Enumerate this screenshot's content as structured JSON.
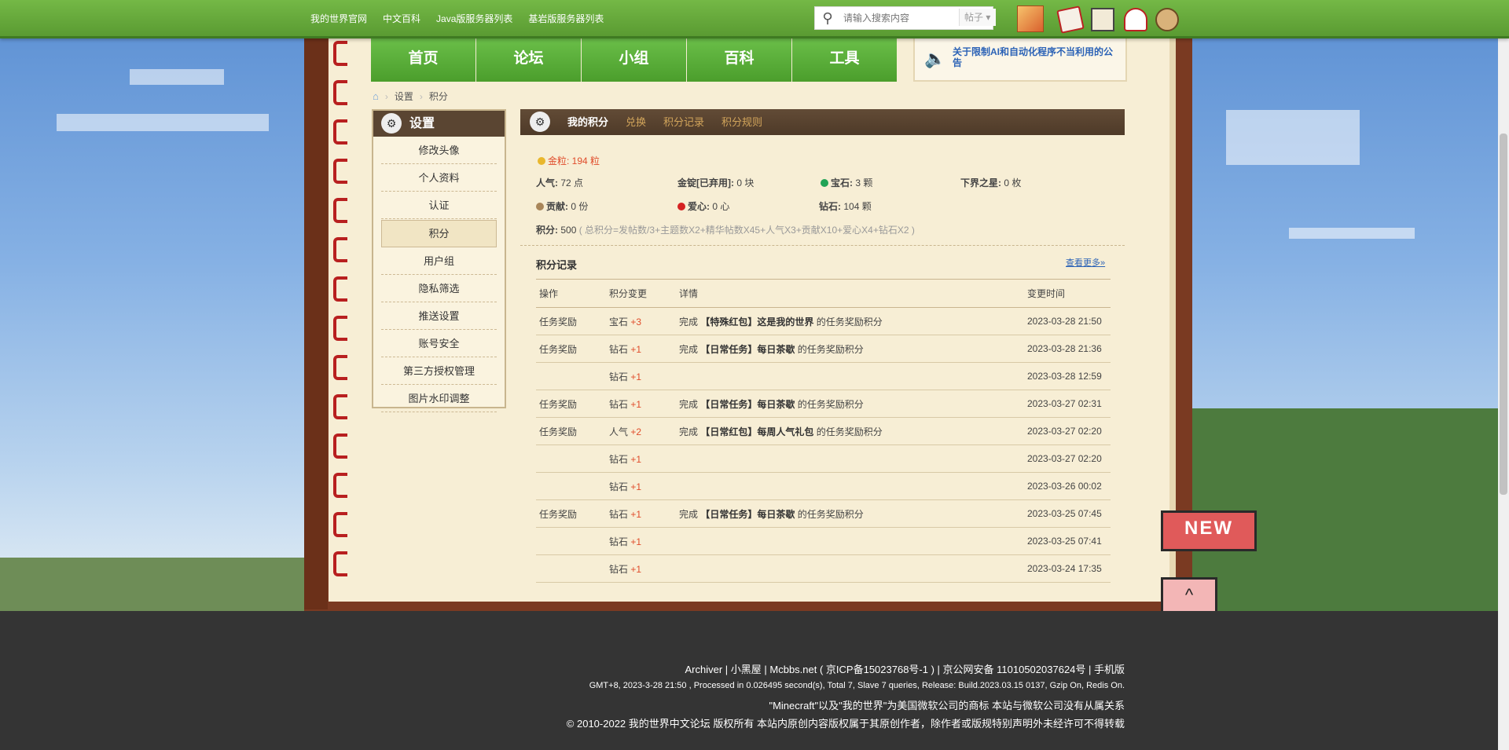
{
  "topnav": {
    "links": [
      "我的世界官网",
      "中文百科",
      "Java版服务器列表",
      "基岩版服务器列表"
    ],
    "search_placeholder": "请输入搜索内容",
    "search_type": "帖子"
  },
  "mainnav": {
    "items": [
      "首页",
      "论坛",
      "小组",
      "百科",
      "工具"
    ]
  },
  "notice": {
    "text": "关于限制AI和自动化程序不当利用的公告"
  },
  "breadcrumb": {
    "items": [
      "设置",
      "积分"
    ]
  },
  "sidebar": {
    "title": "设置",
    "items": [
      "修改头像",
      "个人资料",
      "认证",
      "积分",
      "用户组",
      "隐私筛选",
      "推送设置",
      "账号安全",
      "第三方授权管理",
      "图片水印调整"
    ],
    "active": "积分"
  },
  "content_tabs": [
    "我的积分",
    "兑换",
    "积分记录",
    "积分规则"
  ],
  "stats": {
    "gold": "金粒: 194 粒",
    "popularity_label": "人气:",
    "popularity_value": "72 点",
    "ingot_label": "金锭[已弃用]:",
    "ingot_value": "0 块",
    "gem_label": "宝石:",
    "gem_value": "3 颗",
    "nether_star_label": "下界之星:",
    "nether_star_value": "0 枚",
    "contribution_label": "贡献:",
    "contribution_value": "0 份",
    "love_label": "爱心:",
    "love_value": "0 心",
    "diamond_label": "钻石:",
    "diamond_value": "104 颗",
    "points_label": "积分:",
    "points_value": "500",
    "points_formula": "( 总积分=发帖数/3+主题数X2+精华帖数X45+人气X3+贡献X10+爱心X4+钻石X2 )"
  },
  "records": {
    "title": "积分记录",
    "more": "查看更多»",
    "headers": [
      "操作",
      "积分变更",
      "详情",
      "变更时间"
    ],
    "rows": [
      {
        "op": "任务奖励",
        "type": "宝石",
        "delta": "+3",
        "pre": "完成",
        "name": "【特殊红包】这是我的世界",
        "post": "的任务奖励积分",
        "time": "2023-03-28 21:50"
      },
      {
        "op": "任务奖励",
        "type": "钻石",
        "delta": "+1",
        "pre": "完成",
        "name": "【日常任务】每日茶歇",
        "post": "的任务奖励积分",
        "time": "2023-03-28 21:36"
      },
      {
        "op": "",
        "type": "钻石",
        "delta": "+1",
        "pre": "",
        "name": "",
        "post": "",
        "time": "2023-03-28 12:59"
      },
      {
        "op": "任务奖励",
        "type": "钻石",
        "delta": "+1",
        "pre": "完成",
        "name": "【日常任务】每日茶歇",
        "post": "的任务奖励积分",
        "time": "2023-03-27 02:31"
      },
      {
        "op": "任务奖励",
        "type": "人气",
        "delta": "+2",
        "pre": "完成",
        "name": "【日常红包】每周人气礼包",
        "post": "的任务奖励积分",
        "time": "2023-03-27 02:20"
      },
      {
        "op": "",
        "type": "钻石",
        "delta": "+1",
        "pre": "",
        "name": "",
        "post": "",
        "time": "2023-03-27 02:20"
      },
      {
        "op": "",
        "type": "钻石",
        "delta": "+1",
        "pre": "",
        "name": "",
        "post": "",
        "time": "2023-03-26 00:02"
      },
      {
        "op": "任务奖励",
        "type": "钻石",
        "delta": "+1",
        "pre": "完成",
        "name": "【日常任务】每日茶歇",
        "post": "的任务奖励积分",
        "time": "2023-03-25 07:45"
      },
      {
        "op": "",
        "type": "钻石",
        "delta": "+1",
        "pre": "",
        "name": "",
        "post": "",
        "time": "2023-03-25 07:41"
      },
      {
        "op": "",
        "type": "钻石",
        "delta": "+1",
        "pre": "",
        "name": "",
        "post": "",
        "time": "2023-03-24 17:35"
      }
    ]
  },
  "footer": {
    "line1": "Archiver | 小黑屋 | Mcbbs.net ( 京ICP备15023768号-1 ) | 京公网安备 11010502037624号 | 手机版",
    "line2": "GMT+8, 2023-3-28 21:50 , Processed in 0.026495 second(s), Total 7, Slave 7 queries, Release: Build.2023.03.15 0137, Gzip On, Redis On.",
    "line3": "\"Minecraft\"以及\"我的世界\"为美国微软公司的商标 本站与微软公司没有从属关系",
    "line4": "© 2010-2022 我的世界中文论坛 版权所有 本站内原创内容版权属于其原创作者，除作者或版规特别声明外未经许可不得转载"
  },
  "flags": {
    "new": "NEW",
    "top": "^"
  },
  "colors": {
    "green": "#5fb13c",
    "brown": "#5a4532",
    "paper": "#f7eed5",
    "red_value": "#e04c2b",
    "link_blue": "#2b62b6"
  }
}
